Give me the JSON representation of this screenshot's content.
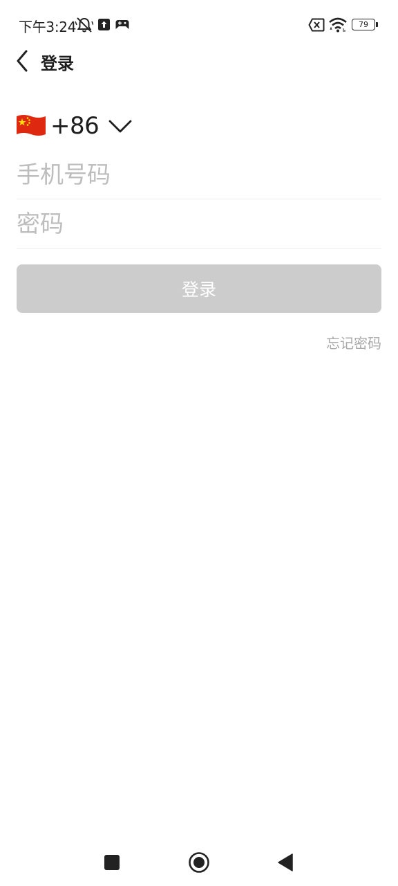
{
  "status_bar": {
    "time": "下午3:24",
    "battery_level": "79",
    "icons": [
      "mute-bell-icon",
      "upload-icon",
      "gamepad-icon",
      "no-sim-icon",
      "wifi-icon",
      "battery-icon"
    ]
  },
  "header": {
    "title": "登录",
    "back_icon": "chevron-left-icon"
  },
  "country": {
    "flag_icon": "china-flag-icon",
    "code": "+86",
    "dropdown_icon": "chevron-down-icon"
  },
  "form": {
    "phone_placeholder": "手机号码",
    "password_placeholder": "密码",
    "phone_value": "",
    "password_value": ""
  },
  "login_button": {
    "label": "登录"
  },
  "forgot_password": {
    "label": "忘记密码"
  },
  "colors": {
    "button_disabled": "#cccccc",
    "placeholder": "#bdbdbd",
    "link": "#a9a9a9",
    "flag_red": "#de2910",
    "flag_star": "#ffde00"
  },
  "nav_bar": {
    "icons": [
      "recents-square-icon",
      "home-circle-icon",
      "back-triangle-icon"
    ]
  }
}
